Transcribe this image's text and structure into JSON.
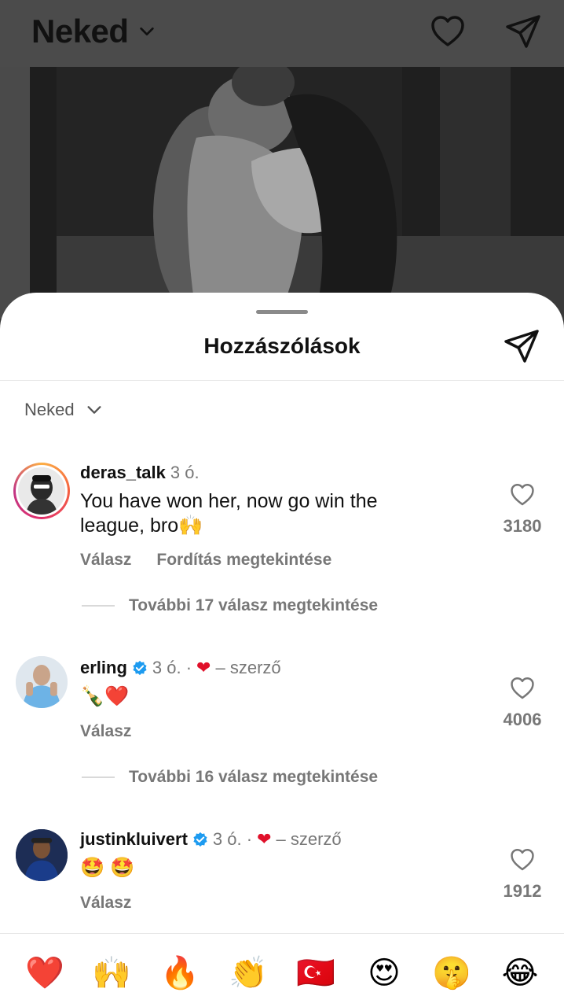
{
  "header": {
    "title": "Neked"
  },
  "sheet": {
    "title": "Hozzászólások",
    "sort_label": "Neked"
  },
  "comments": [
    {
      "username": "deras_talk",
      "time": "3 ó.",
      "text": "You have won her, now go win the league, bro🙌",
      "reply_label": "Válasz",
      "translate_label": "Fordítás megtekintése",
      "likes": "3180",
      "more_replies": "További 17 válasz megtekintése"
    },
    {
      "username": "erling",
      "time": "3 ó. ·",
      "author_tag": "– szerző",
      "text": "🍾❤️",
      "reply_label": "Válasz",
      "likes": "4006",
      "more_replies": "További 16 válasz megtekintése"
    },
    {
      "username": "justinkluivert",
      "time": "3 ó. ·",
      "author_tag": "– szerző",
      "text": "🤩 🤩",
      "reply_label": "Válasz",
      "likes": "1912"
    }
  ],
  "emoji_bar": [
    "❤️",
    "🙌",
    "🔥",
    "👏",
    "🇹🇷",
    "😍",
    "🤫",
    "😂"
  ],
  "colors": {
    "accent_heart": "#e0102a",
    "verified": "#1d9bf0"
  }
}
